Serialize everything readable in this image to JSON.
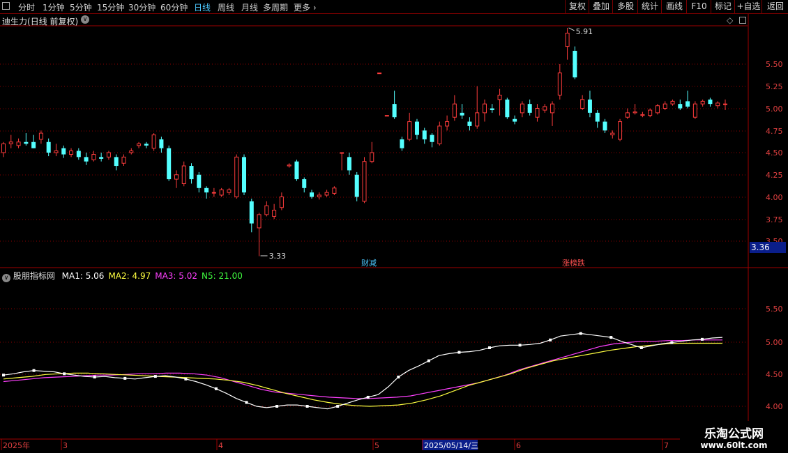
{
  "toolbar": {
    "items": [
      "分时",
      "1分钟",
      "5分钟",
      "15分钟",
      "30分钟",
      "60分钟",
      "日线",
      "周线",
      "月线",
      "多周期",
      "更多"
    ],
    "active_index": 6,
    "right_buttons": [
      "复权",
      "叠加",
      "多股",
      "统计",
      "画线",
      "F10",
      "标记",
      "+自选",
      "返回"
    ]
  },
  "main_panel": {
    "stock_name": "迪生力",
    "period_label": "(日线 前复权)",
    "high_label": "5.91",
    "low_label": "3.33",
    "price_tag": "3.36",
    "y_ticks": [
      "5.50",
      "5.25",
      "5.00",
      "4.75",
      "4.50",
      "4.25",
      "4.00",
      "3.75",
      "3.50"
    ],
    "events": [
      {
        "label": "财减",
        "color": "#4cc9ff"
      },
      {
        "label": "涨榜跌",
        "color": "#ff5050"
      }
    ]
  },
  "indicator_panel": {
    "name": "股朋指标网",
    "legend": [
      {
        "text": "MA1: 5.06",
        "color": "#ffffff"
      },
      {
        "text": "MA2: 4.97",
        "color": "#ffff40"
      },
      {
        "text": "MA3: 5.02",
        "color": "#ff40ff"
      },
      {
        "text": "N5: 21.00",
        "color": "#40ff40"
      }
    ],
    "y_ticks": [
      "5.50",
      "5.00",
      "4.50",
      "4.00"
    ]
  },
  "time_axis": {
    "labels": [
      "2025年",
      "3",
      "4",
      "5",
      "2025/05/14/三",
      "6",
      "7"
    ]
  },
  "watermark": {
    "line1": "乐淘公式网",
    "line2": "www.60lt.com"
  },
  "colors": {
    "up": "#ff3c3c",
    "down": "#54ffff",
    "ma1": "#ffffff",
    "ma2": "#ffff40",
    "ma3": "#ff40ff",
    "grid": "#8b0000"
  },
  "chart_data": {
    "type": "candlestick",
    "ylim": [
      3.3,
      6.0
    ],
    "candles": [
      [
        4.5,
        4.6,
        4.62,
        4.45
      ],
      [
        4.6,
        4.62,
        4.7,
        4.55
      ],
      [
        4.58,
        4.62,
        4.66,
        4.55
      ],
      [
        4.62,
        4.6,
        4.72,
        4.58
      ],
      [
        4.62,
        4.55,
        4.7,
        4.55
      ],
      [
        4.65,
        4.72,
        4.75,
        4.6
      ],
      [
        4.62,
        4.5,
        4.66,
        4.46
      ],
      [
        4.5,
        4.52,
        4.6,
        4.46
      ],
      [
        4.55,
        4.48,
        4.58,
        4.44
      ],
      [
        4.48,
        4.52,
        4.55,
        4.45
      ],
      [
        4.52,
        4.45,
        4.55,
        4.42
      ],
      [
        4.45,
        4.4,
        4.5,
        4.36
      ],
      [
        4.42,
        4.48,
        4.52,
        4.4
      ],
      [
        4.45,
        4.43,
        4.5,
        4.4
      ],
      [
        4.45,
        4.5,
        4.52,
        4.42
      ],
      [
        4.45,
        4.35,
        4.48,
        4.3
      ],
      [
        4.38,
        4.45,
        4.48,
        4.35
      ],
      [
        4.5,
        4.52,
        4.55,
        4.48
      ],
      [
        4.58,
        4.6,
        4.62,
        4.55
      ],
      [
        4.6,
        4.58,
        4.62,
        4.55
      ],
      [
        4.55,
        4.7,
        4.72,
        4.52
      ],
      [
        4.65,
        4.55,
        4.68,
        4.5
      ],
      [
        4.55,
        4.2,
        4.58,
        4.18
      ],
      [
        4.2,
        4.25,
        4.3,
        4.1
      ],
      [
        4.15,
        4.35,
        4.4,
        4.12
      ],
      [
        4.35,
        4.2,
        4.38,
        4.15
      ],
      [
        4.25,
        4.1,
        4.28,
        4.05
      ],
      [
        4.1,
        4.05,
        4.12,
        3.98
      ],
      [
        4.05,
        4.05,
        4.1,
        4.0
      ],
      [
        4.02,
        4.08,
        4.1,
        4.0
      ],
      [
        4.05,
        4.08,
        4.1,
        4.02
      ],
      [
        4.0,
        4.45,
        4.48,
        3.98
      ],
      [
        4.45,
        4.05,
        4.48,
        4.02
      ],
      [
        3.95,
        3.7,
        3.98,
        3.6
      ],
      [
        3.65,
        3.8,
        3.82,
        3.33
      ],
      [
        3.8,
        3.9,
        3.95,
        3.78
      ],
      [
        3.78,
        3.85,
        3.92,
        3.75
      ],
      [
        3.88,
        4.0,
        4.05,
        3.85
      ],
      [
        4.35,
        4.36,
        4.38,
        4.33
      ],
      [
        4.4,
        4.2,
        4.42,
        4.18
      ],
      [
        4.2,
        4.1,
        4.22,
        4.05
      ],
      [
        4.05,
        4.0,
        4.08,
        3.98
      ],
      [
        4.0,
        4.02,
        4.05,
        3.97
      ],
      [
        4.02,
        4.05,
        4.08,
        4.0
      ],
      [
        4.04,
        4.1,
        4.12,
        4.02
      ],
      [
        4.5,
        4.5,
        4.5,
        4.3
      ],
      [
        4.45,
        4.3,
        4.5,
        4.25
      ],
      [
        4.25,
        4.0,
        4.28,
        3.95
      ],
      [
        3.95,
        4.4,
        4.45,
        3.93
      ],
      [
        4.4,
        4.5,
        4.62,
        4.38
      ],
      [
        5.4,
        5.4,
        5.4,
        5.4
      ],
      [
        4.92,
        4.92,
        4.92,
        4.92
      ],
      [
        5.05,
        4.9,
        5.2,
        4.88
      ],
      [
        4.65,
        4.55,
        4.68,
        4.52
      ],
      [
        4.65,
        4.85,
        4.95,
        4.63
      ],
      [
        4.85,
        4.7,
        4.88,
        4.65
      ],
      [
        4.75,
        4.65,
        4.78,
        4.6
      ],
      [
        4.7,
        4.62,
        4.72,
        4.56
      ],
      [
        4.6,
        4.8,
        4.85,
        4.58
      ],
      [
        4.8,
        4.85,
        4.92,
        4.75
      ],
      [
        4.9,
        5.05,
        5.15,
        4.86
      ],
      [
        4.95,
        4.92,
        5.05,
        4.88
      ],
      [
        4.85,
        4.8,
        4.9,
        4.75
      ],
      [
        4.8,
        4.95,
        5.25,
        4.77
      ],
      [
        4.95,
        5.05,
        5.1,
        4.85
      ],
      [
        5.0,
        4.98,
        5.05,
        4.95
      ],
      [
        5.1,
        5.15,
        5.22,
        4.92
      ],
      [
        5.1,
        4.9,
        5.12,
        4.88
      ],
      [
        4.88,
        4.85,
        4.92,
        4.82
      ],
      [
        4.95,
        5.05,
        5.08,
        4.9
      ],
      [
        5.05,
        4.95,
        5.1,
        4.92
      ],
      [
        4.9,
        5.0,
        5.05,
        4.85
      ],
      [
        4.98,
        5.02,
        5.05,
        4.95
      ],
      [
        4.95,
        5.05,
        5.08,
        4.8
      ],
      [
        5.15,
        5.4,
        5.5,
        5.1
      ],
      [
        5.7,
        5.85,
        5.91,
        5.55
      ],
      [
        5.65,
        5.35,
        5.7,
        5.33
      ],
      [
        5.0,
        5.1,
        5.15,
        4.98
      ],
      [
        5.1,
        4.95,
        5.2,
        4.9
      ],
      [
        4.95,
        4.85,
        4.98,
        4.78
      ],
      [
        4.85,
        4.75,
        4.88,
        4.72
      ],
      [
        4.7,
        4.72,
        4.75,
        4.66
      ],
      [
        4.65,
        4.85,
        4.88,
        4.63
      ],
      [
        4.9,
        4.95,
        5.0,
        4.88
      ],
      [
        4.95,
        4.96,
        5.05,
        4.93
      ],
      [
        4.92,
        4.93,
        4.96,
        4.9
      ],
      [
        4.92,
        4.98,
        5.0,
        4.9
      ],
      [
        4.95,
        5.03,
        5.05,
        4.93
      ],
      [
        5.0,
        5.05,
        5.08,
        4.98
      ],
      [
        5.05,
        5.08,
        5.1,
        5.03
      ],
      [
        5.05,
        5.0,
        5.1,
        4.98
      ],
      [
        5.08,
        5.02,
        5.2,
        5.0
      ],
      [
        4.9,
        5.05,
        5.08,
        4.88
      ],
      [
        5.05,
        5.08,
        5.1,
        5.02
      ],
      [
        5.1,
        5.05,
        5.12,
        5.02
      ],
      [
        5.03,
        5.06,
        5.08,
        5.0
      ],
      [
        5.05,
        5.05,
        5.1,
        4.98
      ]
    ],
    "indicator_ylim": [
      3.85,
      6.0
    ],
    "ma1": [
      4.48,
      4.5,
      4.53,
      4.55,
      4.54,
      4.53,
      4.5,
      4.48,
      4.46,
      4.45,
      4.46,
      4.44,
      4.43,
      4.42,
      4.44,
      4.46,
      4.47,
      4.45,
      4.42,
      4.38,
      4.33,
      4.27,
      4.2,
      4.12,
      4.06,
      4.0,
      3.98,
      4.0,
      4.02,
      4.02,
      4.0,
      3.98,
      3.96,
      4.0,
      4.05,
      4.1,
      4.14,
      4.18,
      4.3,
      4.45,
      4.55,
      4.62,
      4.7,
      4.78,
      4.81,
      4.83,
      4.84,
      4.86,
      4.9,
      4.93,
      4.94,
      4.94,
      4.95,
      4.97,
      5.02,
      5.08,
      5.1,
      5.12,
      5.1,
      5.08,
      5.06,
      5.0,
      4.95,
      4.9,
      4.93,
      4.96,
      4.98,
      5.0,
      5.02,
      5.03,
      5.05,
      5.06
    ],
    "ma2": [
      4.42,
      4.44,
      4.46,
      4.49,
      4.5,
      4.51,
      4.51,
      4.5,
      4.49,
      4.48,
      4.47,
      4.46,
      4.45,
      4.44,
      4.43,
      4.42,
      4.4,
      4.37,
      4.32,
      4.26,
      4.2,
      4.15,
      4.1,
      4.06,
      4.03,
      4.01,
      4.0,
      4.01,
      4.02,
      4.05,
      4.1,
      4.16,
      4.24,
      4.32,
      4.38,
      4.44,
      4.5,
      4.58,
      4.64,
      4.7,
      4.74,
      4.78,
      4.82,
      4.86,
      4.89,
      4.92,
      4.94,
      4.96,
      4.97,
      4.97,
      4.97,
      4.97
    ],
    "ma3": [
      4.38,
      4.4,
      4.42,
      4.44,
      4.45,
      4.46,
      4.47,
      4.48,
      4.48,
      4.49,
      4.5,
      4.5,
      4.51,
      4.51,
      4.5,
      4.48,
      4.44,
      4.38,
      4.32,
      4.26,
      4.22,
      4.2,
      4.18,
      4.16,
      4.14,
      4.13,
      4.12,
      4.12,
      4.13,
      4.14,
      4.16,
      4.2,
      4.24,
      4.28,
      4.32,
      4.36,
      4.42,
      4.48,
      4.56,
      4.62,
      4.68,
      4.74,
      4.8,
      4.86,
      4.92,
      4.96,
      4.98,
      5.0,
      5.0,
      5.01,
      5.01,
      5.02,
      5.02,
      5.02
    ],
    "x_labels": [
      "2025年",
      "3",
      "4",
      "5",
      "2025/05/14/三",
      "6",
      "7"
    ]
  }
}
